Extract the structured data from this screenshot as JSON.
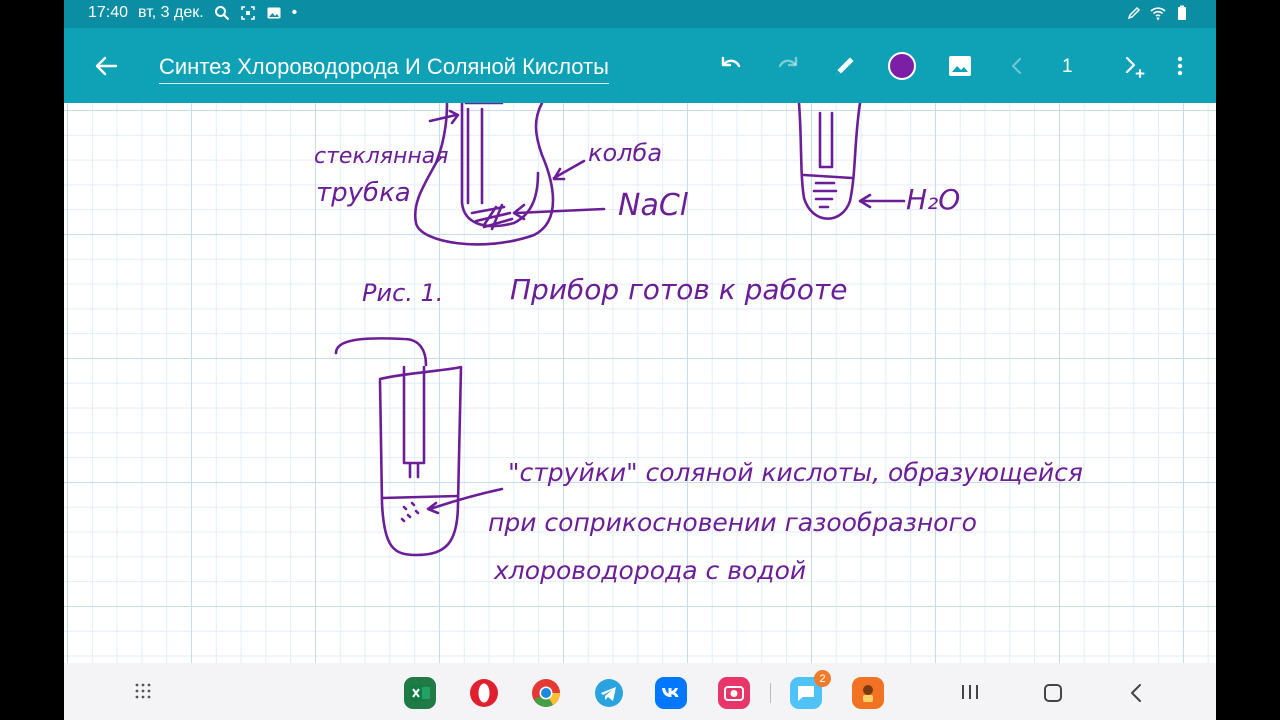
{
  "status_bar": {
    "time": "17:40",
    "date": "вт, 3 дек.",
    "dot": "•"
  },
  "app_bar": {
    "title": "Синтез Хлороводорода И Соляной Кислоты",
    "page_number": "1",
    "pen_color": "#7a1fa6",
    "accent": "#0fa1b6"
  },
  "drawing": {
    "label_glass_tube_1": "стеклянная",
    "label_glass_tube_2": "трубка",
    "label_flask": "колба",
    "label_nacl": "NaCl",
    "label_water": "H₂O",
    "caption_fig": "Рис. 1.",
    "caption_text": "Прибор готов к работе",
    "note_line1": "\"струйки\" соляной кислоты, образующейся",
    "note_line2": "при соприкосновении газообразного",
    "note_line3": "хлороводорода с водой"
  },
  "nav": {
    "badge_count": "2"
  }
}
